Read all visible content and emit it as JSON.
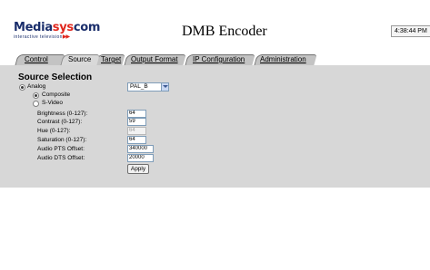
{
  "header": {
    "logo_prefix": "Media",
    "logo_accent": "sys",
    "logo_suffix": "com",
    "logo_tagline": "interactive television",
    "title": "DMB Encoder",
    "clock": "4:38:44 PM"
  },
  "tabs": [
    {
      "label": "Control",
      "active": false
    },
    {
      "label": "Source",
      "active": true
    },
    {
      "label": "Target",
      "active": false
    },
    {
      "label": "Output Format",
      "active": false
    },
    {
      "label": "IP Configuration",
      "active": false
    },
    {
      "label": "Administration",
      "active": false
    }
  ],
  "source": {
    "section_title": "Source Selection",
    "analog": {
      "label": "Analog",
      "checked": true
    },
    "standard_select": {
      "value": "PAL_B"
    },
    "composite": {
      "label": "Composite",
      "checked": true
    },
    "svideo": {
      "label": "S-Video",
      "checked": false
    },
    "fields": {
      "brightness": {
        "label": "Brightness (0-127):",
        "value": "64"
      },
      "contrast": {
        "label": "Contrast (0-127):",
        "value": "59"
      },
      "hue": {
        "label": "Hue (0-127):",
        "value": "64"
      },
      "saturation": {
        "label": "Saturation (0-127):",
        "value": "64"
      },
      "audio_pts": {
        "label": "Audio PTS Offset:",
        "value": "340000"
      },
      "audio_dts": {
        "label": "Audio DTS Offset:",
        "value": "20000"
      }
    },
    "apply_label": "Apply"
  }
}
